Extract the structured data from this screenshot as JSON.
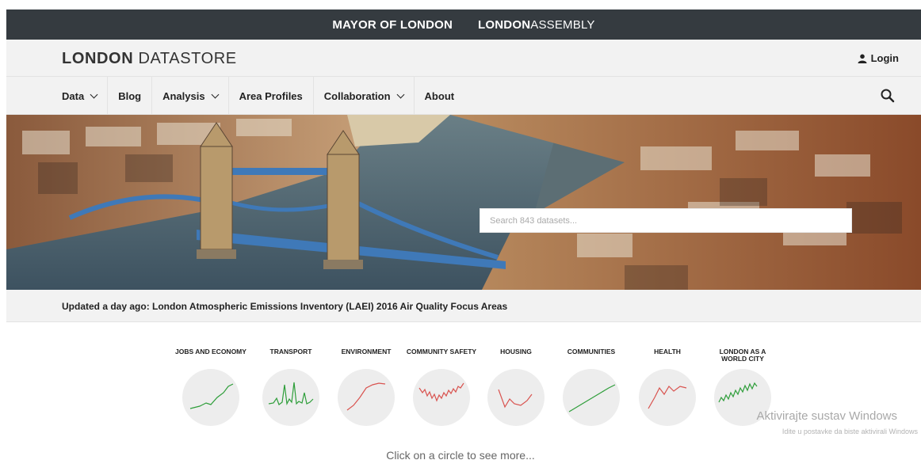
{
  "topbar": {
    "mayor_bold": "MAYOR OF LONDON",
    "assembly_bold": "LONDON",
    "assembly_thin": "ASSEMBLY"
  },
  "header": {
    "logo_bold": "LONDON",
    "logo_thin": "DATASTORE",
    "login_label": "Login",
    "login_icon": "user-icon"
  },
  "nav": {
    "items": [
      {
        "label": "Data",
        "dropdown": true
      },
      {
        "label": "Blog",
        "dropdown": false
      },
      {
        "label": "Analysis",
        "dropdown": true
      },
      {
        "label": "Area Profiles",
        "dropdown": false
      },
      {
        "label": "Collaboration",
        "dropdown": true
      },
      {
        "label": "About",
        "dropdown": false
      }
    ],
    "search_icon": "search-icon"
  },
  "hero": {
    "search_placeholder": "Search 843 datasets..."
  },
  "updated": {
    "text": "Updated a day ago: London Atmospheric Emissions Inventory (LAEI) 2016 Air Quality Focus Areas"
  },
  "categories": [
    {
      "label": "JOBS AND ECONOMY",
      "line_color": "#2e9e3a"
    },
    {
      "label": "TRANSPORT",
      "line_color": "#2e9e3a"
    },
    {
      "label": "ENVIRONMENT",
      "line_color": "#d9534f"
    },
    {
      "label": "COMMUNITY SAFETY",
      "line_color": "#d9534f"
    },
    {
      "label": "HOUSING",
      "line_color": "#d9534f"
    },
    {
      "label": "COMMUNITIES",
      "line_color": "#2e9e3a"
    },
    {
      "label": "HEALTH",
      "line_color": "#d9534f"
    },
    {
      "label": "LONDON AS A WORLD CITY",
      "line_color": "#2e9e3a"
    }
  ],
  "click_more": "Click on a circle to see more...",
  "watermark": {
    "line1": "Aktivirajte sustav Windows",
    "line2": "Idite u postavke da biste aktivirali Windows"
  }
}
